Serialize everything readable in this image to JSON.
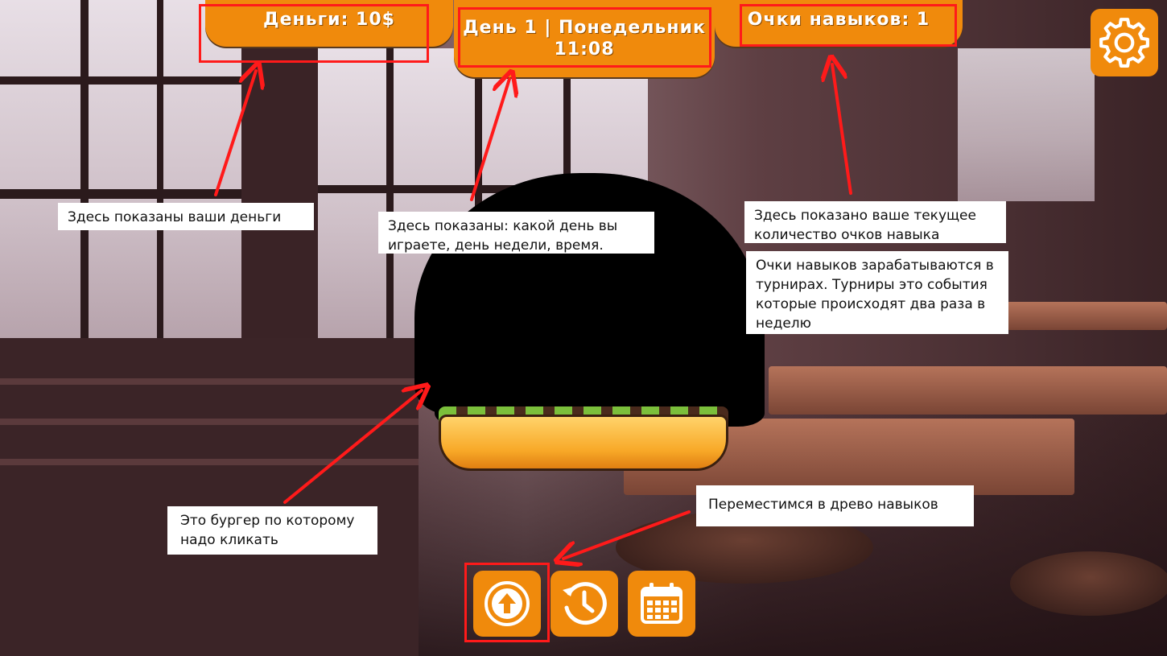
{
  "hud": {
    "money_label": "Деньги: 10$",
    "day_line1": "День 1 | Понедельник",
    "day_line2": "11:08",
    "skill_points_label": "Очки навыков: 1"
  },
  "callouts": {
    "money": "Здесь показаны ваши деньги",
    "day": "Здесь показаны: какой день вы играете, день недели, время.",
    "skill_current": "Здесь показано ваше текущее количество очков навыка",
    "skill_earn": "Очки навыков зарабатываются в турнирах. Турниры это события которые происходят два раза в неделю",
    "burger": "Это бургер по которому надо кликать",
    "skill_tree": "Переместимся в древо навыков"
  },
  "icons": {
    "settings": "gear-icon",
    "skill_tree": "arrow-up-circle-icon",
    "history": "clock-history-icon",
    "calendar": "calendar-icon"
  },
  "colors": {
    "button_orange": "#f08a0c",
    "highlight_red": "#ff1a1a"
  }
}
